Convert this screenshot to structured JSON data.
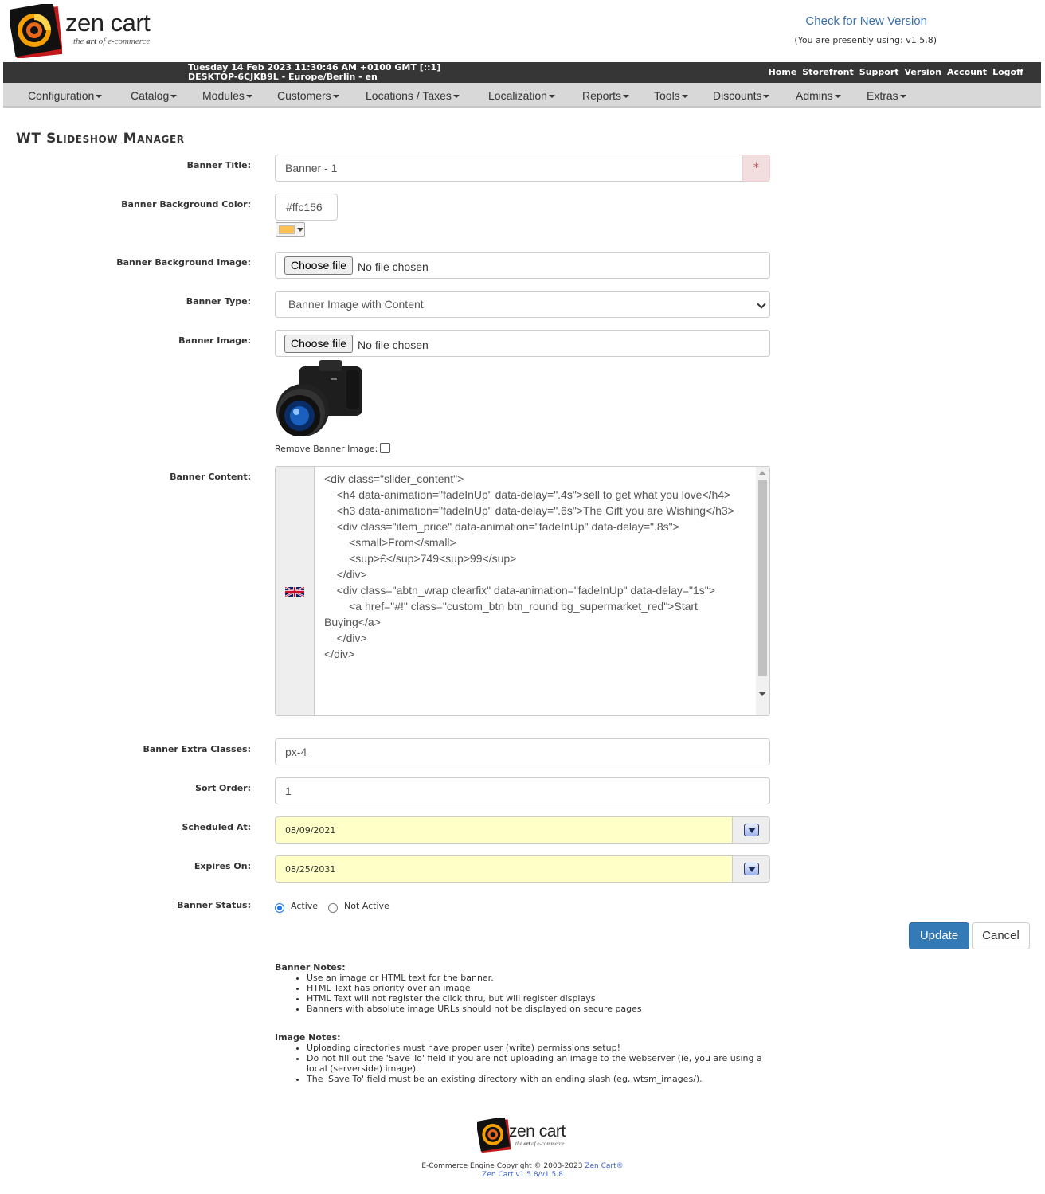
{
  "header": {
    "logo_text": "zen cart",
    "logo_tagline_pre": "the",
    "logo_tagline_art": "art",
    "logo_tagline_post": "of e-commerce",
    "check_version": "Check for New Version",
    "using_version": "(You are presently using: v1.5.8)"
  },
  "topbar": {
    "datetime_line1": "Tuesday 14 Feb 2023 11:30:46 AM +0100 GMT [::1]",
    "datetime_line2": "DESKTOP-6CJKB9L - Europe/Berlin - en",
    "links": [
      "Home",
      "Storefront",
      "Support",
      "Version",
      "Account",
      "Logoff"
    ]
  },
  "menu": [
    "Configuration",
    "Catalog",
    "Modules",
    "Customers",
    "Locations / Taxes",
    "Localization",
    "Reports",
    "Tools",
    "Discounts",
    "Admins",
    "Extras"
  ],
  "page_title": "WT Slideshow Manager",
  "form": {
    "banner_title_label": "Banner Title:",
    "banner_title_value": "Banner - 1",
    "required_mark": "*",
    "bg_color_label": "Banner Background Color:",
    "bg_color_value": "#ffc156",
    "bg_color_swatch": "#ffc156",
    "bg_image_label": "Banner Background Image:",
    "choose_file": "Choose file",
    "no_file": "No file chosen",
    "banner_type_label": "Banner Type:",
    "banner_type_value": "Banner Image with Content",
    "banner_image_label": "Banner Image:",
    "remove_image_label": "Remove Banner Image:",
    "content_label": "Banner Content:",
    "content_value": "<div class=\"slider_content\">\n\t<h4 data-animation=\"fadeInUp\" data-delay=\".4s\">sell to get what you love</h4>\n\t<h3 data-animation=\"fadeInUp\" data-delay=\".6s\">The Gift you are Wishing</h3>\n\t<div class=\"item_price\" data-animation=\"fadeInUp\" data-delay=\".8s\">\n\t\t<small>From</small>\n\t\t<sup>£</sup>749<sup>99</sup>\n\t</div>\n\t<div class=\"abtn_wrap clearfix\" data-animation=\"fadeInUp\" data-delay=\"1s\">\n\t\t<a href=\"#!\" class=\"custom_btn btn_round bg_supermarket_red\">Start Buying</a>\n\t</div>\n</div>",
    "extra_classes_label": "Banner Extra Classes:",
    "extra_classes_value": "px-4",
    "sort_order_label": "Sort Order:",
    "sort_order_value": "1",
    "scheduled_label": "Scheduled At:",
    "scheduled_value": "08/09/2021",
    "expires_label": "Expires On:",
    "expires_value": "08/25/2031",
    "status_label": "Banner Status:",
    "status_active": "Active",
    "status_inactive": "Not Active"
  },
  "buttons": {
    "update": "Update",
    "cancel": "Cancel"
  },
  "banner_notes": {
    "title": "Banner Notes:",
    "items": [
      "Use an image or HTML text for the banner.",
      "HTML Text has priority over an image",
      "HTML Text will not register the click thru, but will register displays",
      "Banners with absolute image URLs should not be displayed on secure pages"
    ]
  },
  "image_notes": {
    "title": "Image Notes:",
    "items": [
      "Uploading directories must have proper user (write) permissions setup!",
      "Do not fill out the 'Save To' field if you are not uploading an image to the webserver (ie, you are using a local (serverside) image).",
      "The 'Save To' field must be an existing directory with an ending slash (eg, wtsm_images/)."
    ]
  },
  "footer": {
    "copyright": "E-Commerce Engine Copyright © 2003-2023",
    "zen_cart_link": "Zen Cart®",
    "version_link": "Zen Cart v1.5.8/v1.5.8"
  }
}
